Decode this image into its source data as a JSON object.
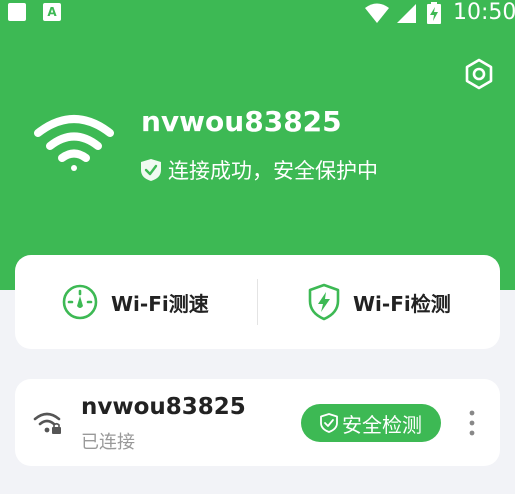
{
  "status_bar": {
    "time": "10:50",
    "icons": [
      "notification-square-icon",
      "app-a-icon",
      "wifi-icon",
      "cell-signal-icon",
      "battery-charging-icon"
    ]
  },
  "header": {
    "ssid": "nvwou83825",
    "connection_status": "连接成功，安全保护中",
    "icons": [
      "settings-icon",
      "wifi-icon",
      "shield-check-icon"
    ],
    "background_color": "#3db954"
  },
  "tools": {
    "speed_test_label": "Wi-Fi测速",
    "wifi_check_label": "Wi-Fi检测",
    "icons": [
      "speedometer-icon",
      "shield-bolt-icon"
    ]
  },
  "network": {
    "ssid": "nvwou83825",
    "status": "已连接",
    "security_button_label": "安全检测",
    "icons": [
      "wifi-lock-icon",
      "shield-check-icon",
      "more-vertical-icon"
    ]
  },
  "colors": {
    "accent": "#3db954",
    "background": "#f2f3f7",
    "card": "#ffffff"
  }
}
